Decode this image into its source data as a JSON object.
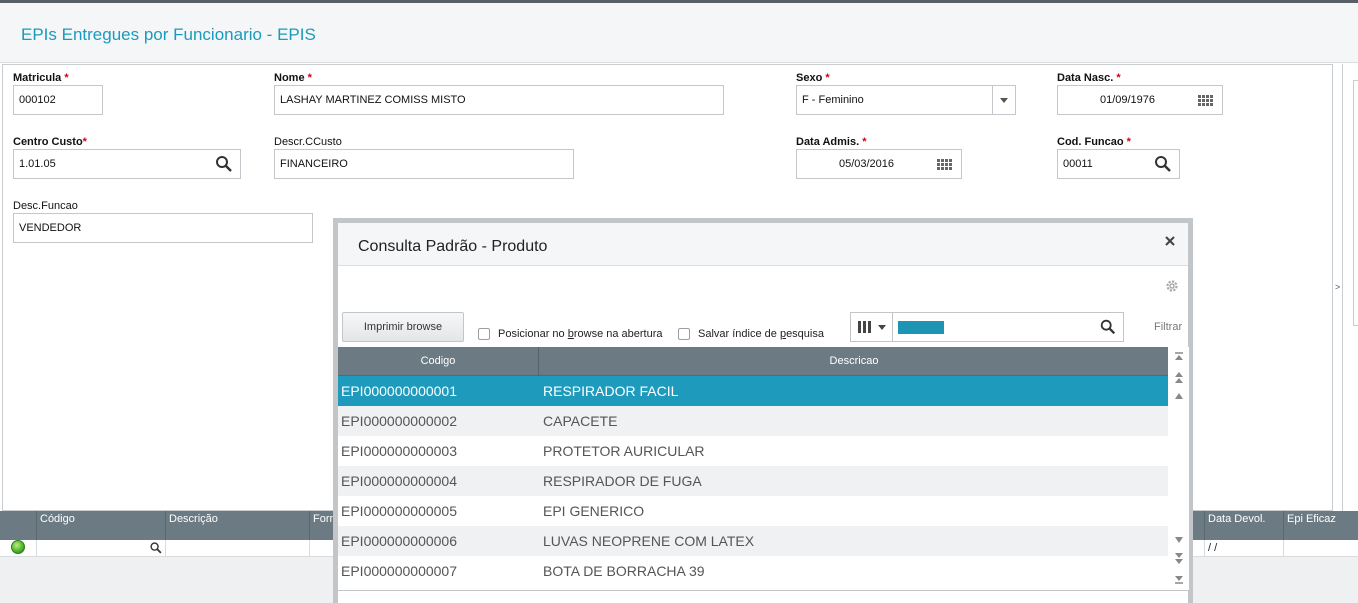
{
  "app": {
    "title": "EPIs Entregues por Funcionario - EPIS"
  },
  "form": {
    "matricula": {
      "label": "Matricula",
      "value": "000102"
    },
    "nome": {
      "label": "Nome",
      "value": "LASHAY MARTINEZ COMISS MISTO"
    },
    "sexo": {
      "label": "Sexo",
      "value": "F - Feminino"
    },
    "data_nasc": {
      "label": "Data Nasc.",
      "value": "01/09/1976"
    },
    "centro_custo": {
      "label": "Centro Custo",
      "value": "1.01.05"
    },
    "descr_ccusto": {
      "label": "Descr.CCusto",
      "value": "FINANCEIRO"
    },
    "data_admis": {
      "label": "Data Admis.",
      "value": "05/03/2016"
    },
    "cod_funcao": {
      "label": "Cod. Funcao",
      "value": "00011"
    },
    "desc_funcao": {
      "label": "Desc.Funcao",
      "value": "VENDEDOR"
    },
    "required_mark": "*"
  },
  "grid": {
    "columns": [
      "Código",
      "Descrição",
      "Forn",
      "Data Devol.",
      "Epi Eficaz"
    ],
    "row": {
      "data_devol": " / /"
    }
  },
  "collapse_glyph": ">",
  "modal": {
    "title": "Consulta Padrão - Produto",
    "print_button": "Imprimir browse",
    "checkbox_posicionar": {
      "before": "Posicionar no ",
      "underlined": "b",
      "after": "rowse na abertura"
    },
    "checkbox_salvar": {
      "before": "Salvar índice de ",
      "underlined": "p",
      "after": "esquisa"
    },
    "filter_label": "Filtrar",
    "columns": {
      "codigo": "Codigo",
      "descricao": "Descricao"
    },
    "rows": [
      {
        "codigo": "EPI000000000001",
        "descricao": "RESPIRADOR FACIL"
      },
      {
        "codigo": "EPI000000000002",
        "descricao": "CAPACETE"
      },
      {
        "codigo": "EPI000000000003",
        "descricao": "PROTETOR AURICULAR"
      },
      {
        "codigo": "EPI000000000004",
        "descricao": "RESPIRADOR DE FUGA"
      },
      {
        "codigo": "EPI000000000005",
        "descricao": "EPI GENERICO"
      },
      {
        "codigo": "EPI000000000006",
        "descricao": "LUVAS NEOPRENE COM LATEX"
      },
      {
        "codigo": "EPI000000000007",
        "descricao": "BOTA DE BORRACHA 39"
      }
    ]
  },
  "colors": {
    "accent": "#1e9bbc",
    "title": "#1a9bbd",
    "grid_header": "#6c7b83",
    "required": "#d0021b"
  },
  "icons": {
    "lookup": "search-icon",
    "date": "calendar-icon",
    "close": "close-icon",
    "settings": "gear-icon",
    "status": "green-status-icon"
  }
}
